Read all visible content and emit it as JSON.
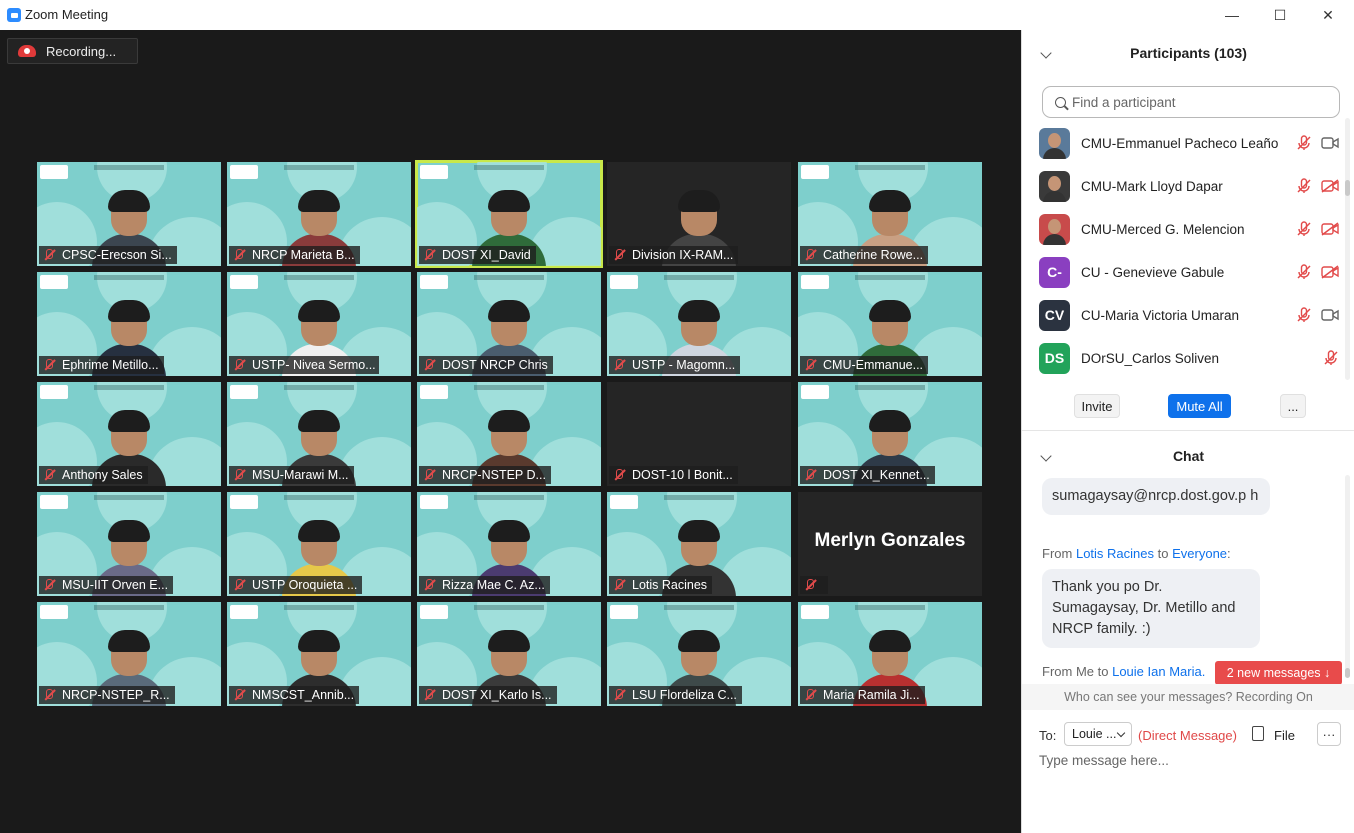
{
  "window": {
    "title": "Zoom Meeting",
    "minimize": "—",
    "maximize": "☐",
    "close": "✕"
  },
  "recording": {
    "label": "Recording..."
  },
  "gallery": {
    "tiles": [
      {
        "name": "CPSC-Erecson Si..."
      },
      {
        "name": "NRCP Marieta B..."
      },
      {
        "name": "DOST XI_David"
      },
      {
        "name": "Division IX-RAM..."
      },
      {
        "name": "Catherine Rowe..."
      },
      {
        "name": "Ephrime Metillo..."
      },
      {
        "name": "USTP- Nivea Sermo..."
      },
      {
        "name": "DOST NRCP Chris"
      },
      {
        "name": "USTP - Magomn..."
      },
      {
        "name": "CMU-Emmanue..."
      },
      {
        "name": "Anthony Sales"
      },
      {
        "name": "MSU-Marawi M..."
      },
      {
        "name": "NRCP-NSTEP D..."
      },
      {
        "name": "DOST-10 l Bonit..."
      },
      {
        "name": "DOST XI_Kennet..."
      },
      {
        "name": "MSU-IIT Orven E..."
      },
      {
        "name": "USTP Oroquieta ..."
      },
      {
        "name": "Rizza Mae C. Az..."
      },
      {
        "name": "Lotis Racines"
      },
      {
        "name": "",
        "big_name": "Merlyn Gonzales"
      },
      {
        "name": "NRCP-NSTEP_R..."
      },
      {
        "name": "NMSCST_Annib..."
      },
      {
        "name": "DOST XI_Karlo Is..."
      },
      {
        "name": "LSU Flordeliza C..."
      },
      {
        "name": "Maria Ramila Ji..."
      }
    ],
    "speaking_index": 2
  },
  "participants": {
    "title": "Participants (103)",
    "search_placeholder": "Find a participant",
    "list": [
      {
        "name": "CMU-Emmanuel Pacheco Leaño",
        "avatar": "photo",
        "color": "#5a7a9a",
        "video": "on"
      },
      {
        "name": "CMU-Mark Lloyd Dapar",
        "avatar": "photo",
        "color": "#3a3a3a",
        "video": "off"
      },
      {
        "name": "CMU-Merced G. Melencion",
        "avatar": "photo",
        "color": "#c84b4b",
        "video": "off"
      },
      {
        "name": "CU - Genevieve Gabule",
        "avatar": "C-",
        "color": "#8a3fc0",
        "video": "off"
      },
      {
        "name": "CU-Maria Victoria Umaran",
        "avatar": "CV",
        "color": "#2b3340",
        "video": "on"
      },
      {
        "name": "DOrSU_Carlos Soliven",
        "avatar": "DS",
        "color": "#22a35a",
        "video": "none"
      }
    ],
    "invite": "Invite",
    "mute_all": "Mute All",
    "more": "..."
  },
  "chat": {
    "title": "Chat",
    "messages": [
      {
        "text": "sumagaysay@nrcp.dost.gov.p h"
      },
      {
        "from_prefix": "From",
        "from": "Lotis Racines",
        "to_word": "to",
        "to": "Everyone",
        "suffix": ":",
        "text": "Thank you po Dr. Sumagaysay, Dr. Metillo and NRCP family. :)"
      },
      {
        "from_prefix": "From Me to",
        "to": "Louie Ian Maria."
      }
    ],
    "new_messages": "2 new messages ↓",
    "visibility": "Who can see your messages? Recording On",
    "to_label": "To:",
    "to_value": "Louie ...",
    "direct": "(Direct Message)",
    "file": "File",
    "more": "···",
    "input_placeholder": "Type message here..."
  }
}
